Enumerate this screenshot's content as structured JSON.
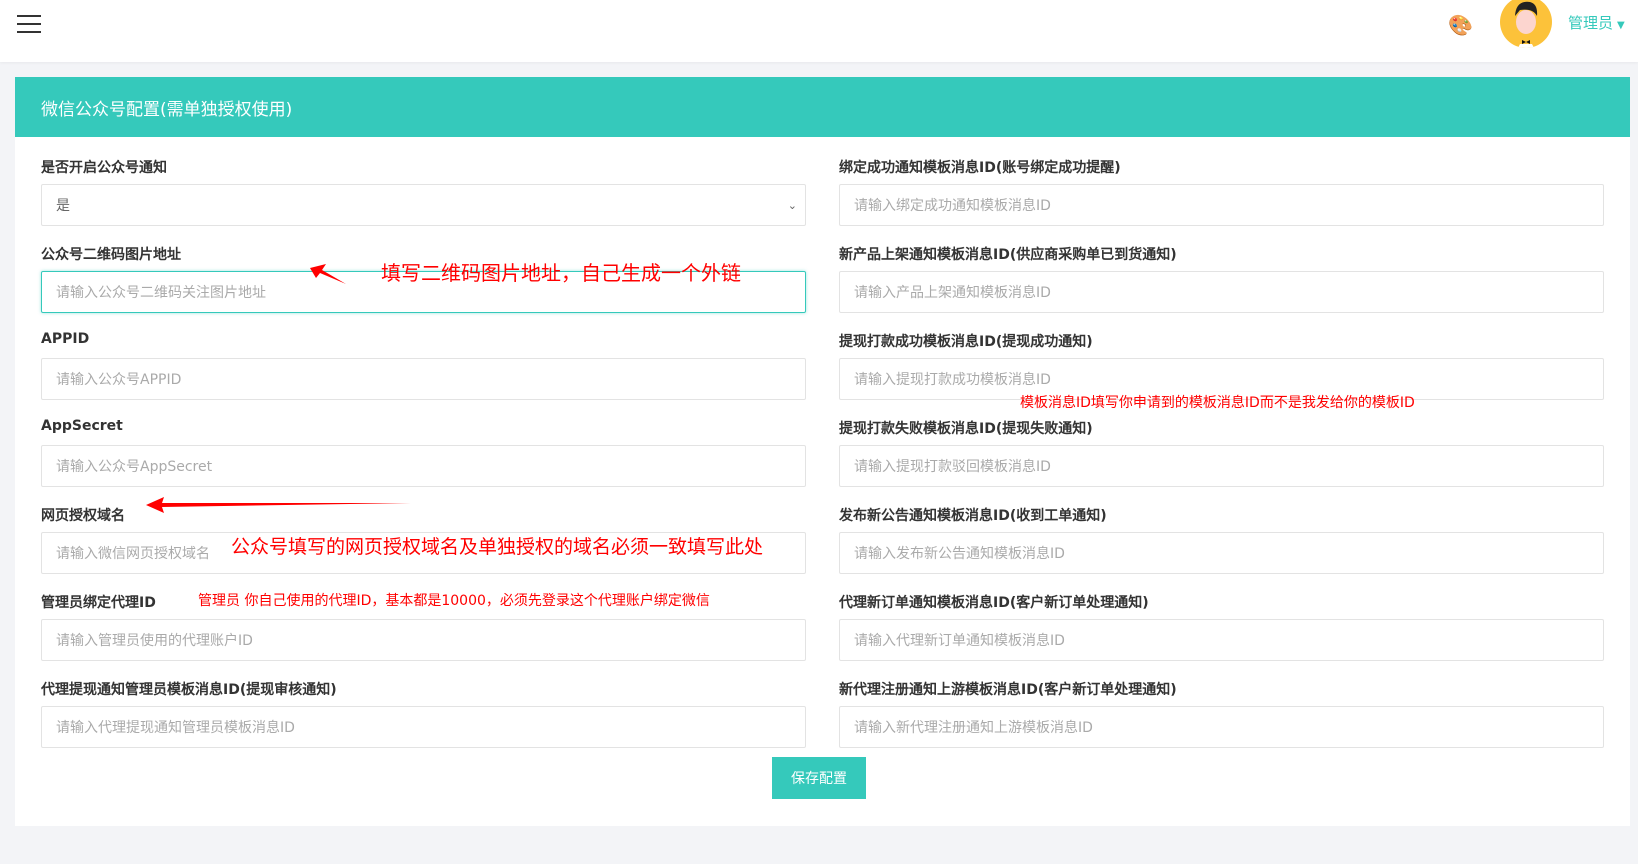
{
  "header": {
    "user": "管理员",
    "menu_icon": "hamburger-icon",
    "theme_icon": "palette-icon"
  },
  "card": {
    "title": "微信公众号配置(需单独授权使用)"
  },
  "left": [
    {
      "label": "是否开启公众号通知",
      "value": "是",
      "type": "select"
    },
    {
      "label": "公众号二维码图片地址",
      "placeholder": "请输入公众号二维码关注图片地址"
    },
    {
      "label": "APPID",
      "placeholder": "请输入公众号APPID"
    },
    {
      "label": "AppSecret",
      "placeholder": "请输入公众号AppSecret"
    },
    {
      "label": "网页授权域名",
      "placeholder": "请输入微信网页授权域名"
    },
    {
      "label": "管理员绑定代理ID",
      "placeholder": "请输入管理员使用的代理账户ID"
    },
    {
      "label": "代理提现通知管理员模板消息ID(提现审核通知)",
      "placeholder": "请输入代理提现通知管理员模板消息ID"
    }
  ],
  "right": [
    {
      "label": "绑定成功通知模板消息ID(账号绑定成功提醒)",
      "placeholder": "请输入绑定成功通知模板消息ID"
    },
    {
      "label": "新产品上架通知模板消息ID(供应商采购单已到货通知)",
      "placeholder": "请输入产品上架通知模板消息ID"
    },
    {
      "label": "提现打款成功模板消息ID(提现成功通知)",
      "placeholder": "请输入提现打款成功模板消息ID"
    },
    {
      "label": "提现打款失败模板消息ID(提现失败通知)",
      "placeholder": "请输入提现打款驳回模板消息ID"
    },
    {
      "label": "发布新公告通知模板消息ID(收到工单通知)",
      "placeholder": "请输入发布新公告通知模板消息ID"
    },
    {
      "label": "代理新订单通知模板消息ID(客户新订单处理通知)",
      "placeholder": "请输入代理新订单通知模板消息ID"
    },
    {
      "label": "新代理注册通知上游模板消息ID(客户新订单处理通知)",
      "placeholder": "请输入新代理注册通知上游模板消息ID"
    }
  ],
  "annotations": {
    "qr": "填写二维码图片地址，自己生成一个外链",
    "domain": "公众号填写的网页授权域名及单独授权的域名必须一致填写此处",
    "admin": "管理员 你自己使用的代理ID，基本都是10000，必须先登录这个代理账户绑定微信",
    "template": "模板消息ID填写你申请到的模板消息ID而不是我发给你的模板ID"
  },
  "save_label": "保存配置"
}
